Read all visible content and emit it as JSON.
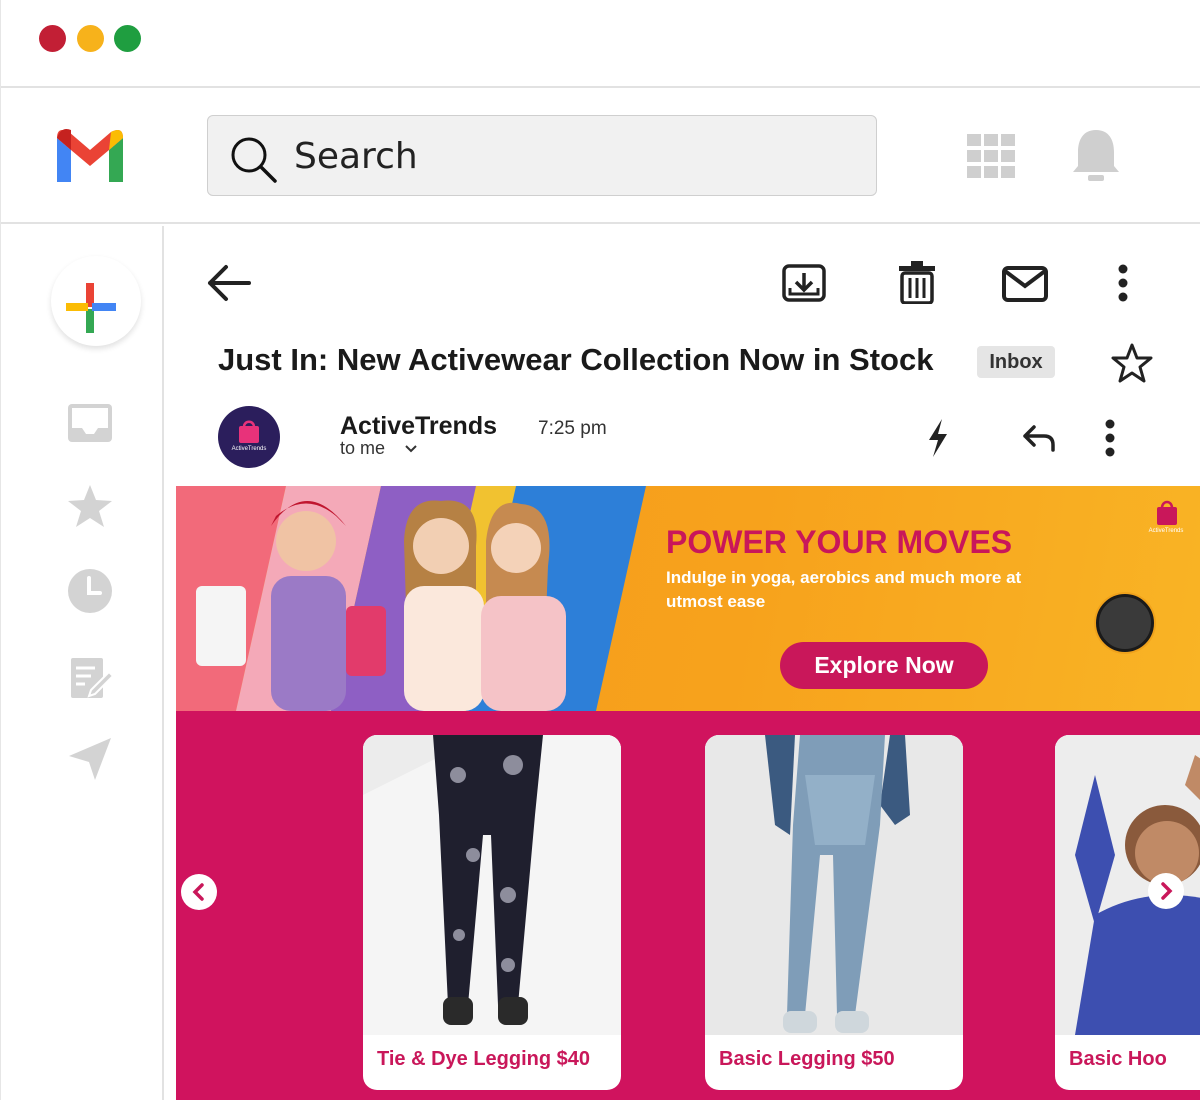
{
  "window": {
    "controls": [
      "close",
      "minimize",
      "maximize"
    ]
  },
  "header": {
    "logo_icon": "gmail-logo-icon",
    "search": {
      "label": "Search"
    },
    "apps_icon": "apps-grid-icon",
    "notifications_icon": "bell-icon"
  },
  "sidebar": {
    "items": [
      {
        "icon": "compose-plus-icon"
      },
      {
        "icon": "inbox-icon"
      },
      {
        "icon": "star-icon"
      },
      {
        "icon": "clock-icon"
      },
      {
        "icon": "drafts-icon"
      },
      {
        "icon": "send-icon"
      }
    ]
  },
  "toolbar": {
    "back_icon": "back-arrow-icon",
    "archive_icon": "archive-icon",
    "delete_icon": "trash-icon",
    "mark_unread_icon": "mail-icon",
    "more_icon": "more-vert-icon"
  },
  "email": {
    "subject": "Just In: New Activewear Collection Now in Stock",
    "label": "Inbox",
    "sender": "ActiveTrends",
    "to": "to me",
    "time": "7:25 pm",
    "avatar_text": "ActiveTrends"
  },
  "banner": {
    "headline": "POWER YOUR MOVES",
    "subtext": "Indulge in yoga, aerobics and much more at utmost ease",
    "cta": "Explore Now",
    "brand": "ActiveTrends"
  },
  "products": [
    {
      "name": "Tie & Dye Legging  $40"
    },
    {
      "name": "Basic Legging  $50"
    },
    {
      "name": "Basic Hoo"
    }
  ],
  "colors": {
    "brand_pink": "#c9175a",
    "banner_orange": "#f7a21c",
    "products_bg": "#d0135e"
  }
}
